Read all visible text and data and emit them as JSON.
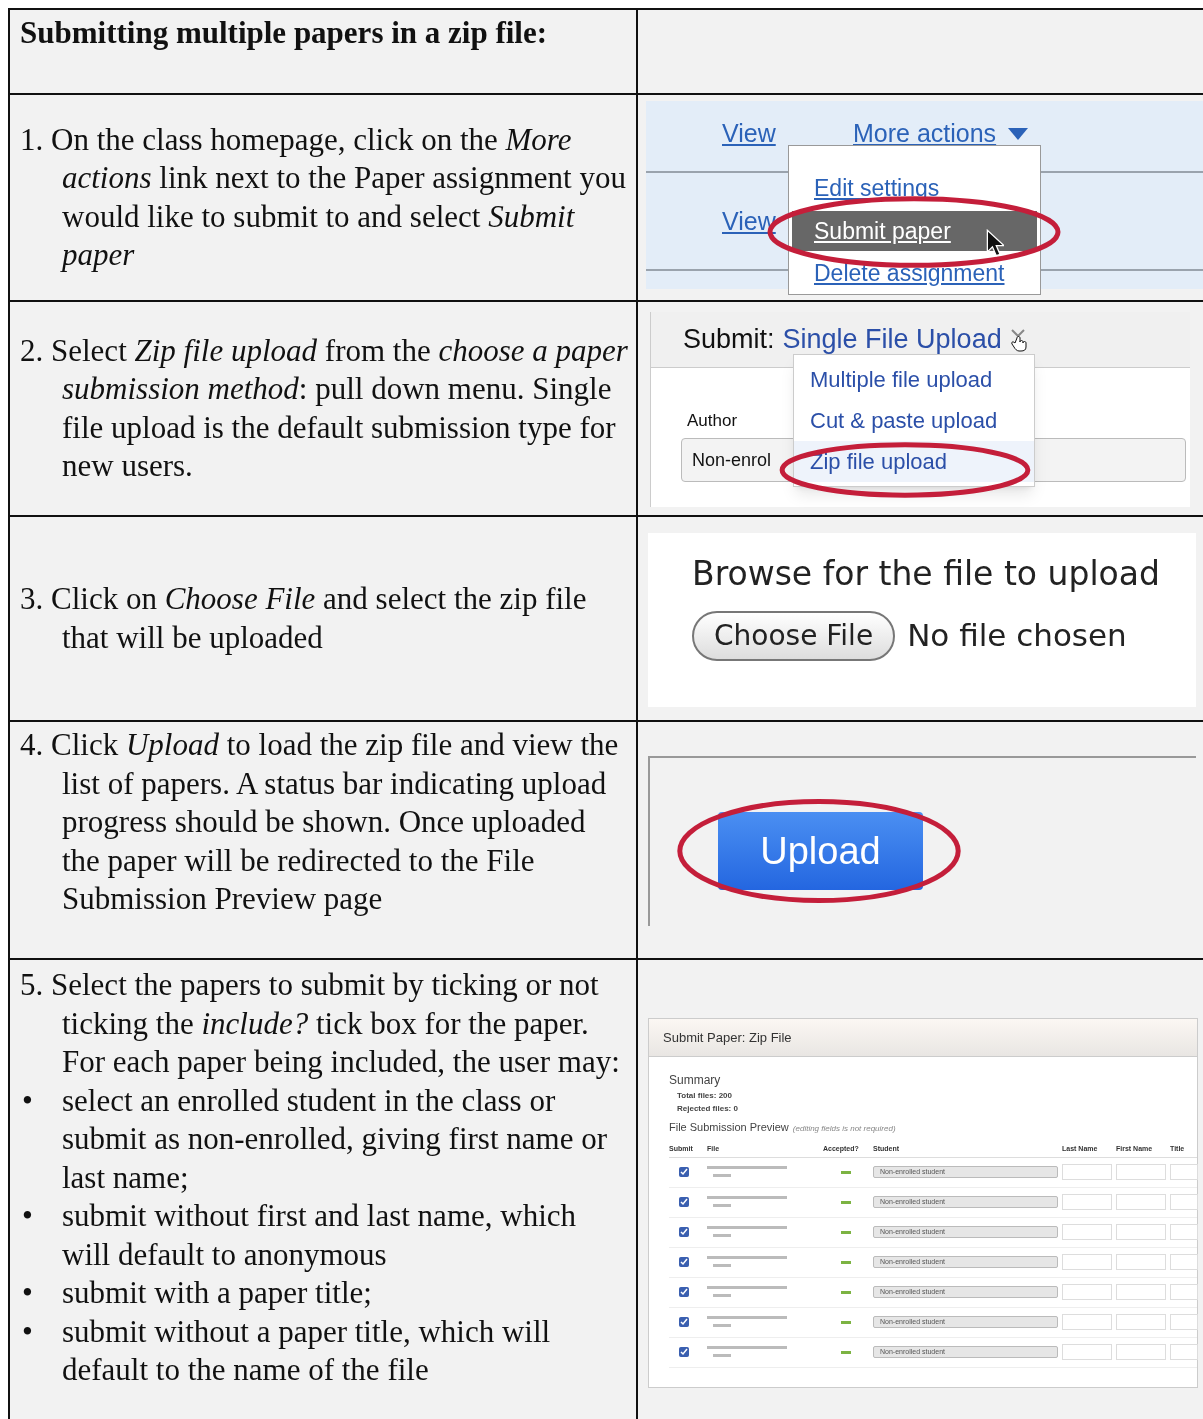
{
  "header": {
    "title": "Submitting multiple papers in a zip file:"
  },
  "steps": [
    {
      "text": "1. On the class homepage, click on the *More actions* link next to the Paper assignment you would like to submit to and select *Submit paper*",
      "screenshot": {
        "kind": "actions",
        "links": [
          "View",
          "View"
        ],
        "menu_link": "More actions",
        "menu": [
          {
            "label": "Edit settings",
            "selected": false
          },
          {
            "label": "Submit paper",
            "selected": true
          },
          {
            "label": "Delete assignment",
            "selected": false
          }
        ]
      }
    },
    {
      "text": "2. Select *Zip file upload* from the *choose a paper submission method*: pull down menu. Single file upload is the default submission type for new users.",
      "screenshot": {
        "kind": "method",
        "prefix": "Submit:",
        "current": "Single File Upload",
        "author_label": "Author",
        "author_value": "Non-enrol",
        "menu": [
          {
            "label": "Multiple file upload",
            "selected": false
          },
          {
            "label": "Cut & paste upload",
            "selected": false
          },
          {
            "label": "Zip file upload",
            "selected": true
          }
        ]
      }
    },
    {
      "text": "3. Click on *Choose File* and select the zip file that will be uploaded",
      "screenshot": {
        "kind": "file",
        "heading": "Browse for the file to upload",
        "button": "Choose File",
        "status": "No file chosen"
      }
    },
    {
      "text": "4. Click *Upload* to load the zip file and view the list of papers. A status bar indicating upload progress should be shown. Once uploaded the paper will be redirected to the File Submission Preview page",
      "screenshot": {
        "kind": "upload",
        "button": "Upload"
      }
    },
    {
      "text": "5. Select the papers to submit by ticking or not ticking the *include?* tick box for the paper. For each paper being included, the user may:",
      "bullets": [
        {
          "marker": "•",
          "text": "select an enrolled student in the class or submit as non-enrolled, giving first name or last name;"
        },
        {
          "marker": "•",
          "text": "submit without first and last name, which will default to anonymous"
        },
        {
          "marker": "•",
          "text": "submit with a paper title;"
        },
        {
          "marker": "•",
          "text": "submit without a paper title, which will default to the name of the file"
        }
      ],
      "screenshot": {
        "kind": "preview",
        "title": "Submit Paper: Zip File",
        "summary": "Summary",
        "summary_items": [
          "Total files: 200",
          "Rejected files: 0"
        ],
        "preview_title": "File Submission Preview",
        "preview_note": "(editing fields is not required)",
        "columns": [
          "Submit",
          "File",
          "Accepted?",
          "Student",
          "Last Name",
          "First Name",
          "Title"
        ],
        "rows": [
          {
            "checked": true,
            "student": "Non-enrolled student"
          },
          {
            "checked": true,
            "student": "Non-enrolled student"
          },
          {
            "checked": true,
            "student": "Non-enrolled student"
          },
          {
            "checked": true,
            "student": "Non-enrolled student"
          },
          {
            "checked": true,
            "student": "Non-enrolled student"
          },
          {
            "checked": true,
            "student": "Non-enrolled student"
          },
          {
            "checked": true,
            "student": "Non-enrolled student"
          }
        ]
      }
    }
  ]
}
